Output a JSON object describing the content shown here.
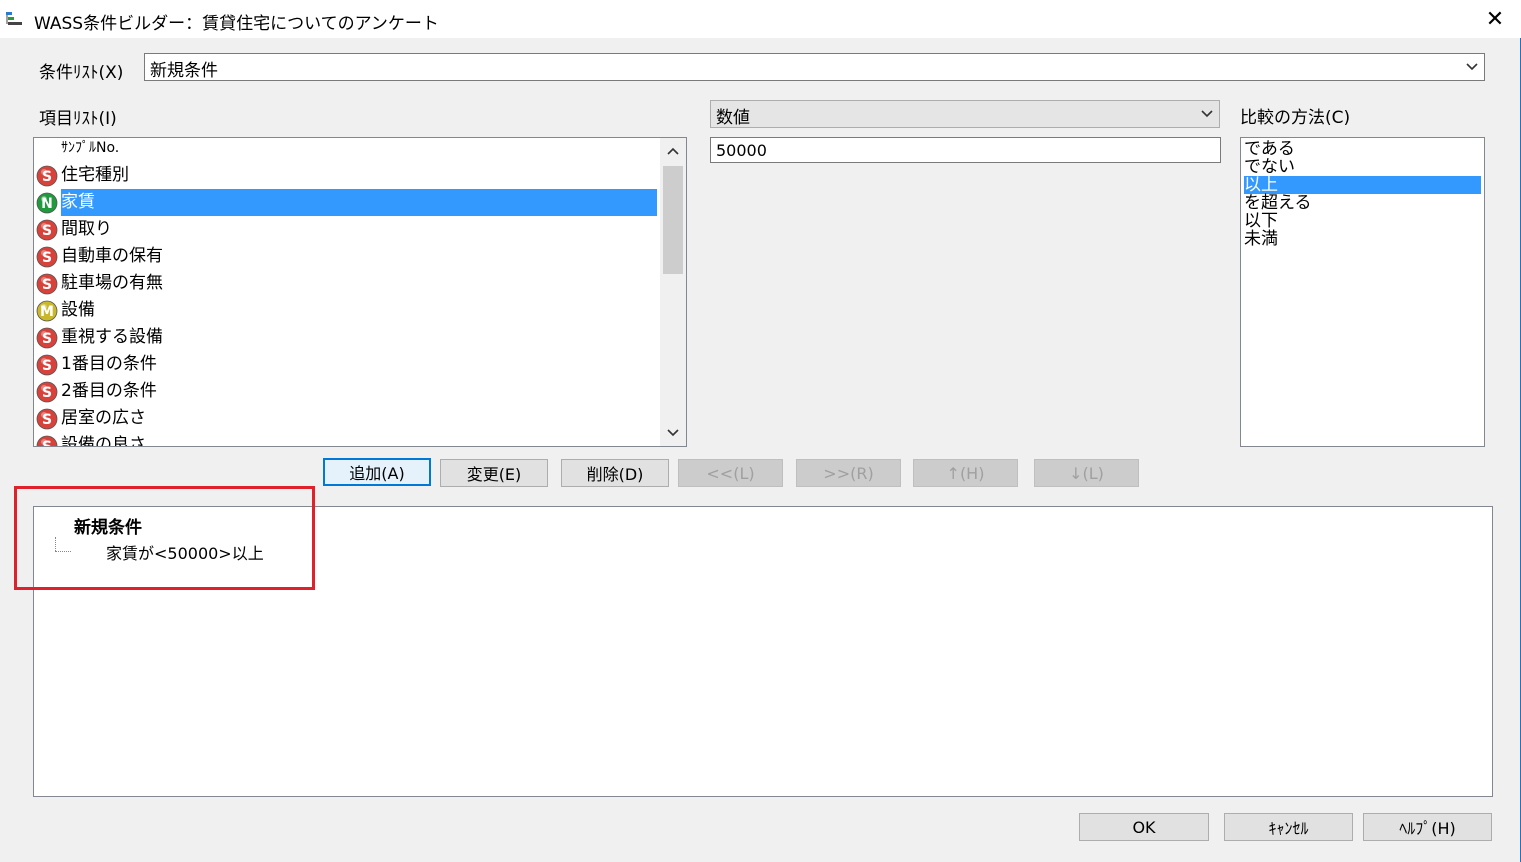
{
  "window": {
    "title": "WASS条件ビルダー：賃貸住宅についてのアンケート",
    "close_glyph": "✕"
  },
  "condition_list": {
    "label": "条件ﾘｽﾄ(X)",
    "value": "新規条件"
  },
  "item_list": {
    "label": "項目ﾘｽﾄ(I)",
    "items": [
      {
        "badge": "",
        "label": "ｻﾝﾌﾟﾙNo."
      },
      {
        "badge": "S",
        "label": "住宅種別"
      },
      {
        "badge": "N",
        "label": "家賃",
        "selected": true
      },
      {
        "badge": "S",
        "label": "間取り"
      },
      {
        "badge": "S",
        "label": "自動車の保有"
      },
      {
        "badge": "S",
        "label": "駐車場の有無"
      },
      {
        "badge": "M",
        "label": "設備"
      },
      {
        "badge": "S",
        "label": "重視する設備"
      },
      {
        "badge": "S",
        "label": "1番目の条件"
      },
      {
        "badge": "S",
        "label": "2番目の条件"
      },
      {
        "badge": "S",
        "label": "居室の広さ"
      },
      {
        "badge": "S",
        "label": "設備の良さ"
      }
    ]
  },
  "value_type": {
    "value": "数値"
  },
  "value_input": {
    "value": "50000"
  },
  "comparison": {
    "label": "比較の方法(C)",
    "options": [
      "である",
      "でない",
      "以上",
      "を超える",
      "以下",
      "未満"
    ],
    "selected_index": 2
  },
  "action_buttons": {
    "add": "追加(A)",
    "change": "変更(E)",
    "delete": "削除(D)",
    "shift_left": "<<(L)",
    "shift_right": ">>(R)",
    "up": "↑(H)",
    "down": "↓(L)"
  },
  "condition_tree": {
    "root": "新規条件",
    "children": [
      "家賃が<50000>以上"
    ]
  },
  "dialog_buttons": {
    "ok": "OK",
    "cancel": "ｷｬﾝｾﾙ",
    "help": "ﾍﾙﾌﾟ(H)"
  },
  "colors": {
    "badge_S": "#d9423b",
    "badge_N": "#1f9a3c",
    "badge_M": "#c9b82a",
    "selection": "#3399ff",
    "highlight": "#e0202a"
  }
}
